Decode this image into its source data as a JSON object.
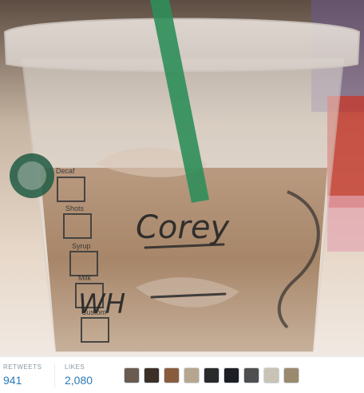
{
  "photo": {
    "cup_labels": [
      "Decaf",
      "Shots",
      "Syrup",
      "Milk",
      "Custom"
    ],
    "handwritten_name": "Corey",
    "handwritten_mark": "WH"
  },
  "stats": {
    "retweets_label": "RETWEETS",
    "retweets_value": "941",
    "likes_label": "LIKES",
    "likes_value": "2,080"
  },
  "avatars": [
    {
      "name": "user-avatar-1",
      "color": "#6b5b4f"
    },
    {
      "name": "user-avatar-2",
      "color": "#3c2f27"
    },
    {
      "name": "user-avatar-3",
      "color": "#8a5c3e"
    },
    {
      "name": "user-avatar-4",
      "color": "#b7a68f"
    },
    {
      "name": "user-avatar-5",
      "color": "#2a2a2a"
    },
    {
      "name": "user-avatar-6",
      "color": "#1d1f24"
    },
    {
      "name": "user-avatar-7",
      "color": "#4f4f4f"
    },
    {
      "name": "user-avatar-8",
      "color": "#c9c3b6"
    },
    {
      "name": "user-avatar-9",
      "color": "#9b8a6e"
    }
  ]
}
